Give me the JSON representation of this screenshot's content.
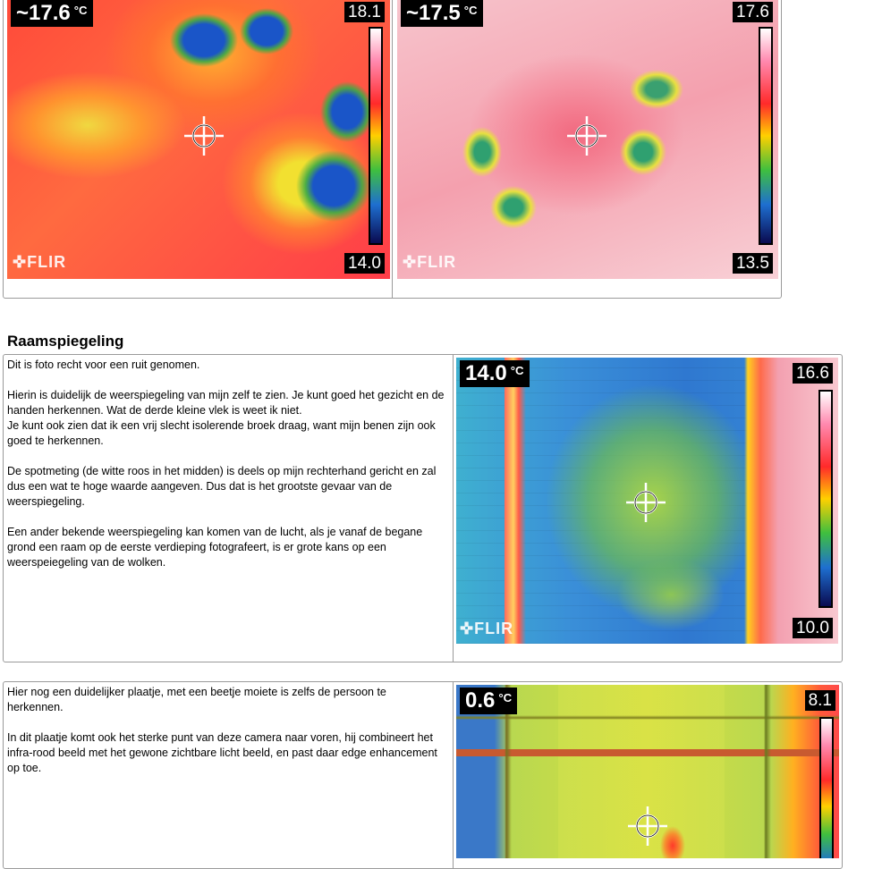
{
  "images": {
    "img1": {
      "spot": "~17.6",
      "unit": "°C",
      "max": "18.1",
      "min": "14.0",
      "logo": "FLIR"
    },
    "img2": {
      "spot": "~17.5",
      "unit": "°C",
      "max": "17.6",
      "min": "13.5",
      "logo": "FLIR"
    },
    "img3": {
      "spot": "14.0",
      "unit": "°C",
      "max": "16.6",
      "min": "10.0",
      "logo": "FLIR"
    },
    "img4": {
      "spot": "0.6",
      "unit": "°C",
      "max": "8.1"
    }
  },
  "section": {
    "heading": "Raamspiegeling",
    "box1": {
      "p1": "Dit is  foto recht voor een ruit genomen.",
      "p2a": "Hierin is duidelijk de weerspiegeling van mijn zelf te zien. Je kunt goed het gezicht en de handen herkennen. Wat de derde kleine vlek is weet ik niet.",
      "p2b": "Je kunt ook zien dat ik een vrij slecht isolerende broek draag,  want mijn benen zijn ook goed te herkennen.",
      "p3": "De spotmeting (de witte roos in het midden) is deels op mijn rechterhand gericht en zal dus een wat te hoge waarde aangeven. Dus dat is het grootste gevaar van de weerspiegeling.",
      "p4": "Een ander bekende weerspiegeling kan komen van de lucht, als je vanaf de begane grond een raam op de eerste verdieping fotografeert, is er grote kans op een weerspeiegeling van de wolken."
    },
    "box2": {
      "p1": "Hier nog een duidelijker plaatje,  met een beetje moiete is zelfs de persoon te herkennen.",
      "p2": "In dit plaatje komt ook het sterke punt van deze camera naar voren, hij combineert het infra-rood beeld met het gewone zichtbare licht beeld, en past daar edge enhancement op toe."
    }
  },
  "colors": {
    "border": "#9a9a9a",
    "text": "#000000"
  }
}
